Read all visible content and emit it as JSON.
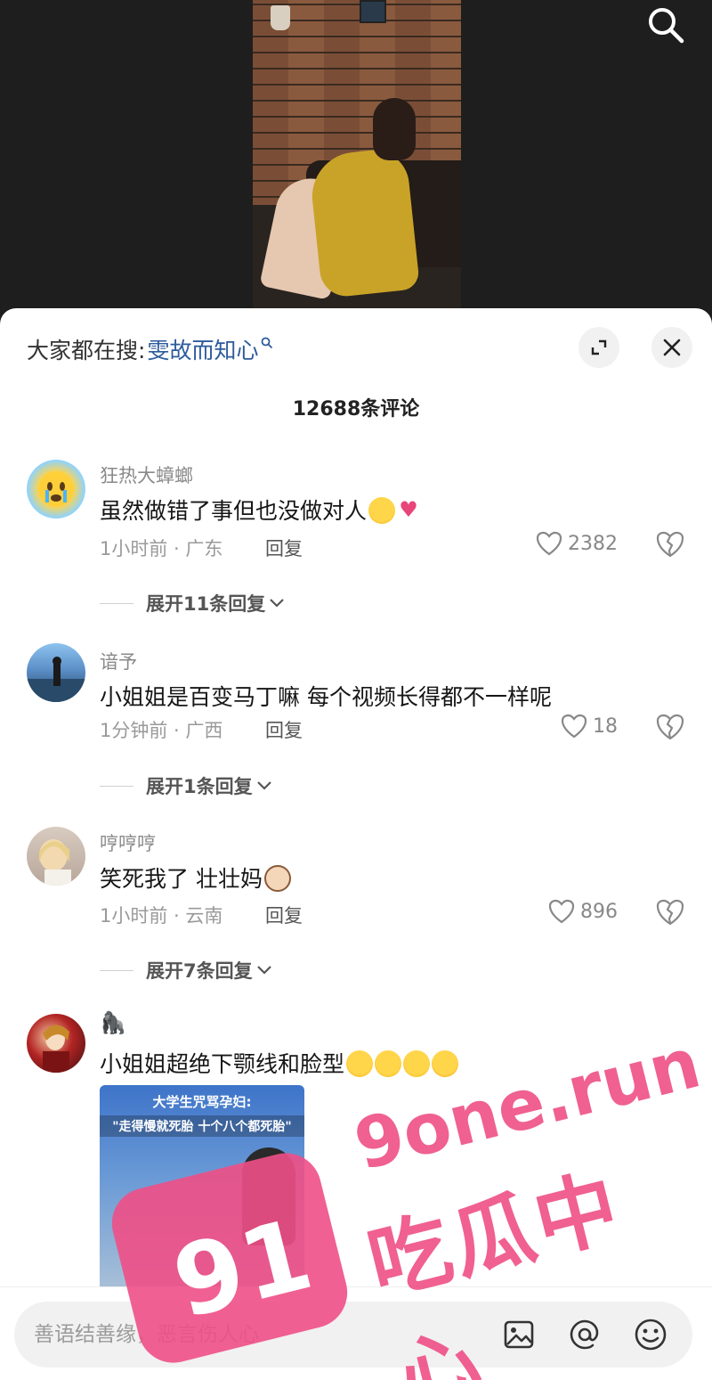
{
  "hot_search": {
    "label": "大家都在搜:",
    "term": "雯故而知心"
  },
  "comment_count": "12688条评论",
  "comments": [
    {
      "user": "狂热大蟑螂",
      "text": "虽然做错了事但也没做对人",
      "time": "1小时前 · 广东",
      "reply": "回复",
      "likes": "2382",
      "expand": "展开11条回复"
    },
    {
      "user": "谙予",
      "text": "小姐姐是百变马丁嘛 每个视频长得都不一样呢",
      "time": "1分钟前 · 广西",
      "reply": "回复",
      "likes": "18",
      "expand": "展开1条回复"
    },
    {
      "user": "哼哼哼",
      "text": "笑死我了 壮壮妈",
      "time": "1小时前 · 云南",
      "reply": "回复",
      "likes": "896",
      "expand": "展开7条回复"
    },
    {
      "user": "🦍",
      "text": "小姐姐超绝下颚线和脸型"
    }
  ],
  "thumbnail": {
    "line1": "大学生咒骂孕妇:",
    "line2": "\"走得慢就死胎 十个八个都死胎\""
  },
  "input": {
    "placeholder": "善语结善缘，恶言伤人心"
  },
  "watermark": {
    "badge": "91",
    "url": "9one.run",
    "cn": "吃瓜中心"
  },
  "colors": {
    "accent_link": "#2d5b9c",
    "watermark": "#ef4f86"
  }
}
